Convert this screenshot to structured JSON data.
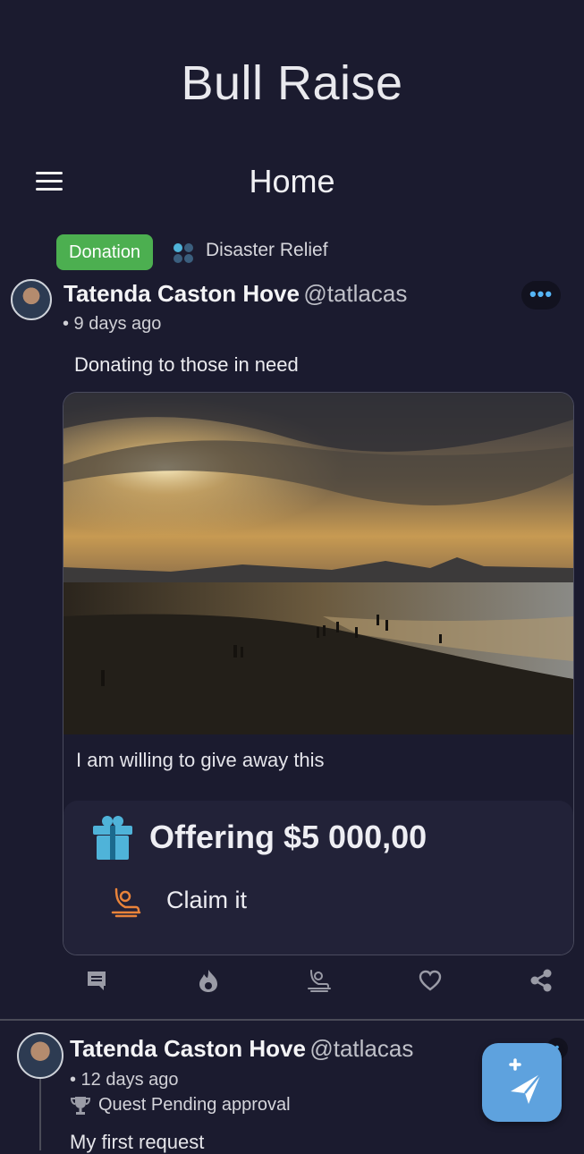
{
  "app": {
    "title": "Bull Raise"
  },
  "header": {
    "page_title": "Home"
  },
  "posts": [
    {
      "badge": "Donation",
      "category": "Disaster Relief",
      "author": "Tatenda Caston Hove",
      "handle": "@tatlacas",
      "time": "• 9 days ago",
      "text": "Donating to those in need",
      "card_text": "I am willing to give away this",
      "offer": "Offering $5 000,00",
      "claim_label": "Claim it",
      "more": "•••"
    },
    {
      "author": "Tatenda Caston Hove",
      "handle": "@tatlacas",
      "time": "• 12 days ago",
      "status": "Quest Pending approval",
      "text": "My first request"
    }
  ],
  "colors": {
    "background": "#1b1b2f",
    "badge": "#4caf50",
    "fab": "#5ea2de",
    "accent": "#56b6f7",
    "gift": "#4fb3d9",
    "claim": "#e9833a"
  },
  "icons": [
    "menu-icon",
    "category-icon",
    "more-icon",
    "gift-icon",
    "claim-icon",
    "comment-icon",
    "fire-icon",
    "claim-action-icon",
    "heart-icon",
    "share-icon",
    "trophy-icon",
    "send-icon"
  ]
}
